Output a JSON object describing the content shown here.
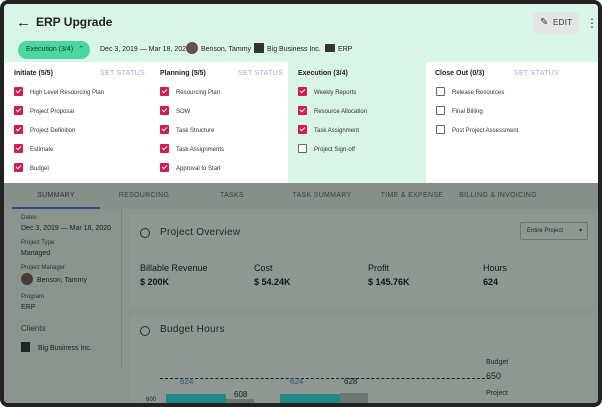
{
  "header": {
    "title": "ERP Upgrade",
    "edit_label": "EDIT",
    "phase_pill": "Execution (3/4)",
    "dates": "Dec 3, 2019 — Mar 18, 2020",
    "manager": "Benson, Tammy",
    "client": "Big Business Inc.",
    "program": "ERP"
  },
  "phases": [
    {
      "title": "Initiate (5/5)",
      "set_status": "SET STATUS",
      "tasks": [
        {
          "label": "High Level Resourcing Plan",
          "checked": true
        },
        {
          "label": "Project Proposal",
          "checked": true
        },
        {
          "label": "Project Definition",
          "checked": true
        },
        {
          "label": "Estimate",
          "checked": true
        },
        {
          "label": "Budget",
          "checked": true
        }
      ]
    },
    {
      "title": "Planning (5/5)",
      "set_status": "SET STATUS",
      "tasks": [
        {
          "label": "Resourcing Plan",
          "checked": true
        },
        {
          "label": "SOW",
          "checked": true
        },
        {
          "label": "Task Structure",
          "checked": true
        },
        {
          "label": "Task Assignments",
          "checked": true
        },
        {
          "label": "Approval to Start",
          "checked": true
        }
      ]
    },
    {
      "title": "Execution (3/4)",
      "set_status": "",
      "tasks": [
        {
          "label": "Weekly Reports",
          "checked": true
        },
        {
          "label": "Resource Allocation",
          "checked": true
        },
        {
          "label": "Task Assignment",
          "checked": true
        },
        {
          "label": "Project Sign-off",
          "checked": false
        }
      ]
    },
    {
      "title": "Close Out (0/3)",
      "set_status": "SET STATUS",
      "tasks": [
        {
          "label": "Release Resources",
          "checked": false
        },
        {
          "label": "Final Billing",
          "checked": false
        },
        {
          "label": "Post Project Assessment",
          "checked": false
        }
      ]
    }
  ],
  "tabs": [
    "SUMMARY",
    "RESOURCING",
    "TASKS",
    "TASK SUMMARY",
    "TIME & EXPENSE",
    "BILLING & INVOICING"
  ],
  "sidebar": {
    "dates_label": "Dates",
    "dates_value": "Dec 3, 2019 — Mar 18, 2020",
    "type_label": "Project Type",
    "type_value": "Managed",
    "manager_label": "Project Manager",
    "manager_value": "Benson, Tammy",
    "program_label": "Program",
    "program_value": "ERP",
    "clients_label": "Clients",
    "client_value": "Big Business Inc."
  },
  "overview": {
    "title": "Project Overview",
    "filter": "Entire Project",
    "metrics": [
      {
        "label": "Billable Revenue",
        "value": "$ 200K"
      },
      {
        "label": "Cost",
        "value": "$ 54.24K"
      },
      {
        "label": "Profit",
        "value": "$ 145.76K"
      },
      {
        "label": "Hours",
        "value": "624"
      }
    ]
  },
  "budget_hours": {
    "title": "Budget Hours",
    "labels": [
      "624",
      "608",
      "624",
      "628"
    ],
    "budget_label": "Budget",
    "budget_value": "650",
    "project_label": "Project",
    "axis_label": "600"
  },
  "colors": {
    "header_bg": "#d8f5e8",
    "pill": "#4cd6a0",
    "checkbox": "#d81b4d",
    "bar_teal": "#1f8a86",
    "bar_gray": "#6f7774"
  }
}
